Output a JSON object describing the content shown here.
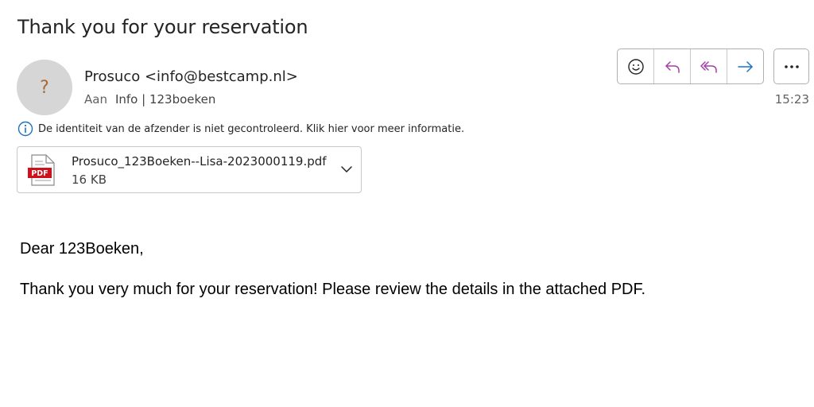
{
  "message": {
    "subject": "Thank you for your reservation",
    "sender": "Prosuco <info@bestcamp.nl>",
    "avatar_glyph": "?",
    "to_label": "Aan",
    "recipients": "Info | 123boeken",
    "time": "15:23",
    "sender_warning": "De identiteit van de afzender is niet gecontroleerd. Klik hier voor meer informatie."
  },
  "attachment": {
    "filename": "Prosuco_123Boeken--Lisa-2023000119.pdf",
    "size": "16 KB",
    "type_label": "PDF"
  },
  "body": {
    "greeting": "Dear 123Boeken,",
    "paragraph": "Thank you very much for your reservation! Please review the details in the attached PDF."
  },
  "toolbar": {
    "icons": [
      "emoji-icon",
      "reply-icon",
      "reply-all-icon",
      "forward-icon",
      "more-icon"
    ],
    "accent_colors": {
      "reply": "#a33fa6",
      "forward": "#1a73c9",
      "info": "#1a73c9",
      "pdf": "#d0101b"
    }
  }
}
